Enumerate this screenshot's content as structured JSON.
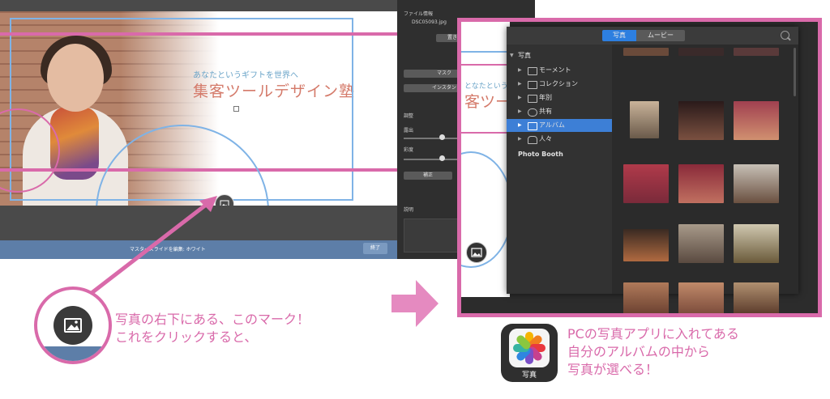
{
  "left_screenshot": {
    "slide_subtitle": "あなたというギフトを世界へ",
    "slide_title": "集客ツールデザイン塾",
    "status_text": "マスタースライドを編集: ホワイト",
    "done_label": "終了",
    "inspector": {
      "file_info": "ファイル情報",
      "filename": "DSC05093.jpg",
      "replace": "置き",
      "mask": "マスク",
      "instant_alpha": "インスタン",
      "adjust": "調整",
      "exposure": "露出",
      "saturation": "彩度",
      "enhance": "補正",
      "description": "説明"
    }
  },
  "callout_text": [
    "写真の右下にある、このマーク！",
    "これをクリックすると、"
  ],
  "right_screenshot": {
    "tabs": [
      "写真",
      "ムービー"
    ],
    "sidebar": {
      "root": "写真",
      "items": [
        "モーメント",
        "コレクション",
        "年別",
        "共有",
        "アルバム",
        "人々"
      ],
      "extra": "Photo Booth"
    },
    "peek_text": "となたという",
    "peek_title": "客ツー"
  },
  "right_caption": [
    "PCの写真アプリに入れてある",
    "自分のアルバムの中から",
    "写真が選べる！"
  ],
  "app_icon_label": "写真",
  "colors": {
    "accent_pink": "#d96aaa",
    "selection_blue": "#3d7fd6",
    "status_blue": "#5d7ea8"
  }
}
